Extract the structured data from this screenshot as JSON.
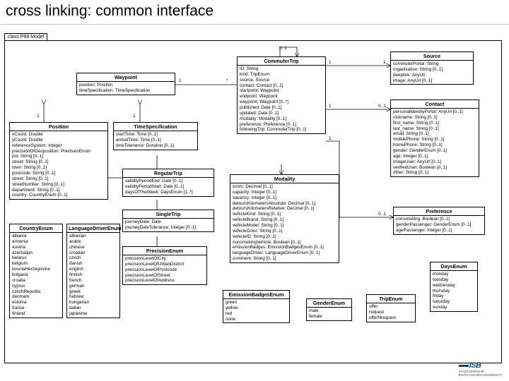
{
  "title": "cross linking: common interface",
  "pkg": {
    "tab": "class P99 Model"
  },
  "classes": {
    "waypoint": {
      "name": "Waypoint",
      "attrs": [
        "position: Position",
        "timeSpecification: TimeSpecification"
      ]
    },
    "position": {
      "name": "Position",
      "attrs": [
        "xCoord: Double",
        "yCoord: Double",
        "referenceSystem: Integer",
        "precisionOfGeoposition: PrecisionEnum",
        "poi: String [0..1]",
        "street: String [0..1]",
        "town: String [0..1]",
        "postcode: String [0..1]",
        "street: String [0..1]",
        "streetNumber: String [0..1]",
        "department: String [0..1]",
        "country: CountryEnum [0..1]"
      ]
    },
    "timespec": {
      "name": "TimeSpecification",
      "attrs": [
        "startTime: Time [0..1]",
        "arrivalTime: Time [0..1]",
        "timeTolerance: Duration [0..1]"
      ]
    },
    "commutertrip": {
      "name": "CommuterTrip",
      "attrs": [
        "ID: String",
        "kind: TripEnum",
        "source: Source",
        "contact: Contact [0..1]",
        "startpoint: Waypoint",
        "endpoint: Waypoint",
        "waypoint: Waypoint [0..*]",
        "published: Date [0..1]",
        "updated: Date [0..1]",
        "modality: Modality [0..1]",
        "preference: Preference [0..1]",
        "followingTrip: CommuterTrip [0..1]"
      ]
    },
    "source": {
      "name": "Source",
      "attrs": [
        "commuterPortal: String",
        "organisation: String [0..1]",
        "deeplink: AnyUrl",
        "image: AnyUrl [0..1]"
      ]
    },
    "contact": {
      "name": "Contact",
      "attrs": [
        "personalIdentityPortal: AnyUrl [0..1]",
        "nickname: String [0..1]",
        "first_name: String [0..1]",
        "last_name: String [0..1]",
        "email: String [0..1]",
        "mobilePhone: String [0..1]",
        "homePhone: String [0..1]",
        "gender: GenderEnum [0..1]",
        "age: Integer [0..1]",
        "imageUser: AnyUrl [0..1]",
        "verifiedUser: Boolean [0..1]",
        "other: String [0..1]"
      ]
    },
    "regulartrip": {
      "name": "RegularTrip",
      "attrs": [
        "validityPeriodEnd: Date [0..1]",
        "validityPeriodStart: Date [0..1]",
        "daysOfTheWeek: DaysEnum [1..*]"
      ]
    },
    "singletrip": {
      "name": "SingleTrip",
      "attrs": [
        "journeyDate: Date",
        "journeyDateTolerance: Integer [0..1]"
      ]
    },
    "modality": {
      "name": "Modality",
      "attrs": [
        "costs: Decimal [0..1]",
        "capacity: Integer [0..1]",
        "vacancy: Integer [0..1]",
        "detoursKilometersAbsolute: Decimal [0..1]",
        "detoursKilometersRelative: Decimal [0..1]",
        "vehicleKind: String [0..1]",
        "vehicleBrand: String [0..1]",
        "vehicleModel: String [0..1]",
        "vehicleColor: String [0..1]",
        "vehicleID: String [0..1]",
        "nonsmokingVehicle: Boolean [0..1]",
        "emissionBadges: EmissionBadgesEnum [0..1]",
        "languageDriver: LanguageDriverEnum [0..1]",
        "comment: String [0..1]"
      ]
    },
    "preference": {
      "name": "Preference",
      "attrs": [
        "nonsmoking: Boolean [0..1]",
        "genderPassenger: GenderEnum [0..1]",
        "agePassenger: Integer [0..1]"
      ]
    },
    "precisionenum": {
      "name": "PrecisionEnum",
      "attrs": [
        "precisionLevelOfCity",
        "precisionLevelOfUrbanDistrict",
        "precisionLevelOfPostcode",
        "precisionLevelOfStreet",
        "precisionLevelOfAddress"
      ]
    },
    "emissionenum": {
      "name": "EmissionBadgesEnum",
      "attrs": [
        "green",
        "yellow",
        "red",
        "none"
      ]
    },
    "genderenum": {
      "name": "GenderEnum",
      "attrs": [
        "male",
        "female"
      ]
    },
    "tripenum": {
      "name": "TripEnum",
      "attrs": [
        "offer",
        "request",
        "offerNrequest"
      ]
    },
    "daysenum": {
      "name": "DaysEnum",
      "attrs": [
        "monday",
        "tuesday",
        "wednesday",
        "thursday",
        "friday",
        "saturday",
        "sunday"
      ]
    },
    "countryenum": {
      "name": "CountryEnum",
      "attrs": [
        "albania",
        "armenia",
        "austria",
        "azerbaijan",
        "belarus",
        "belgium",
        "bosniaHerzegovina",
        "bulgaria",
        "croatia",
        "cyprus",
        "czechRepublic",
        "denmark",
        "estonia",
        "france",
        "finland"
      ]
    },
    "langenum": {
      "name": "LanguageDriverEnum",
      "attrs": [
        "albanian",
        "arabic",
        "chinese",
        "croatian",
        "czech",
        "danish",
        "english",
        "finnish",
        "french",
        "german",
        "greek",
        "hebrew",
        "hungarian",
        "italian",
        "japanese"
      ]
    }
  },
  "mults": {
    "m1": "0..1",
    "m2": "1",
    "m3": "1",
    "m4": "1",
    "m5": "*",
    "m6": "1",
    "m7": "1",
    "m8": "1",
    "m9": "0..1",
    "m10": "1",
    "m11": "0..1"
  },
  "logo": {
    "main": "ISB",
    "sub1": "STADTVERKEHR",
    "sub2": "RWTH AACHEN UNIVERSITY"
  }
}
